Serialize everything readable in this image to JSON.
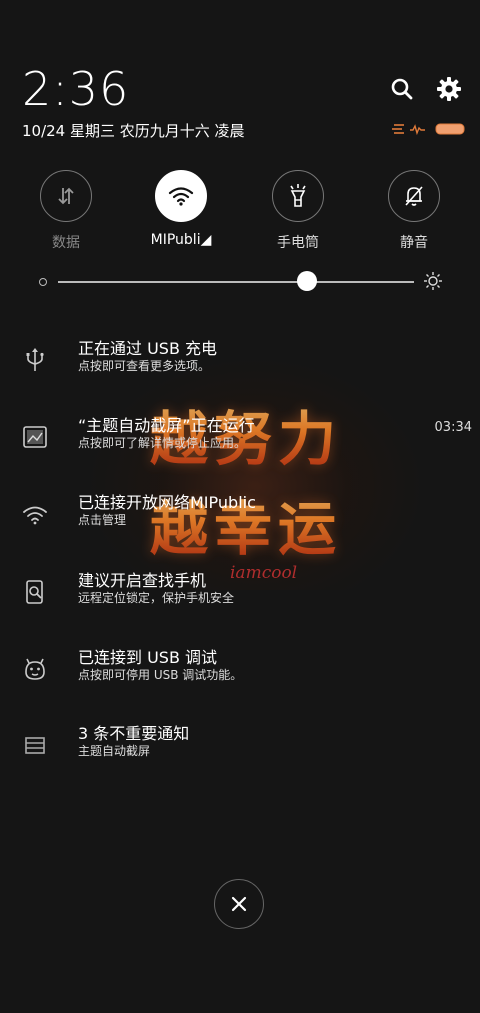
{
  "header": {
    "time": "2:36",
    "date": "10/24  星期三  农历九月十六  凌晨"
  },
  "quick_toggles": [
    {
      "label": "数据",
      "icon": "data-arrows-icon",
      "active": false
    },
    {
      "label": "MIPubli◢",
      "icon": "wifi-icon",
      "active": true
    },
    {
      "label": "手电筒",
      "icon": "flashlight-icon",
      "active": false
    },
    {
      "label": "静音",
      "icon": "bell-off-icon",
      "active": false
    }
  ],
  "brightness": {
    "level": 0.7
  },
  "wallpaper": {
    "line1": "越努力",
    "line2": "越幸运",
    "signature": "iamcool"
  },
  "notifications": [
    {
      "icon": "usb-icon",
      "title": "正在通过 USB 充电",
      "subtitle": "点按即可查看更多选项。",
      "time": ""
    },
    {
      "icon": "screenshot-app-icon",
      "title": "“主题自动截屏”正在运行",
      "subtitle": "点按即可了解详情或停止应用。",
      "time": "03:34"
    },
    {
      "icon": "wifi-icon",
      "title": "已连接开放网络MIPublic",
      "subtitle": "点击管理",
      "time": ""
    },
    {
      "icon": "find-phone-icon",
      "title": "建议开启查找手机",
      "subtitle": "远程定位锁定，保护手机安全",
      "time": ""
    },
    {
      "icon": "android-debug-icon",
      "title": "已连接到 USB 调试",
      "subtitle": "点按即可停用 USB 调试功能。",
      "time": ""
    },
    {
      "icon": "stack-icon",
      "title": "3 条不重要通知",
      "subtitle": "主题自动截屏",
      "time": ""
    }
  ]
}
